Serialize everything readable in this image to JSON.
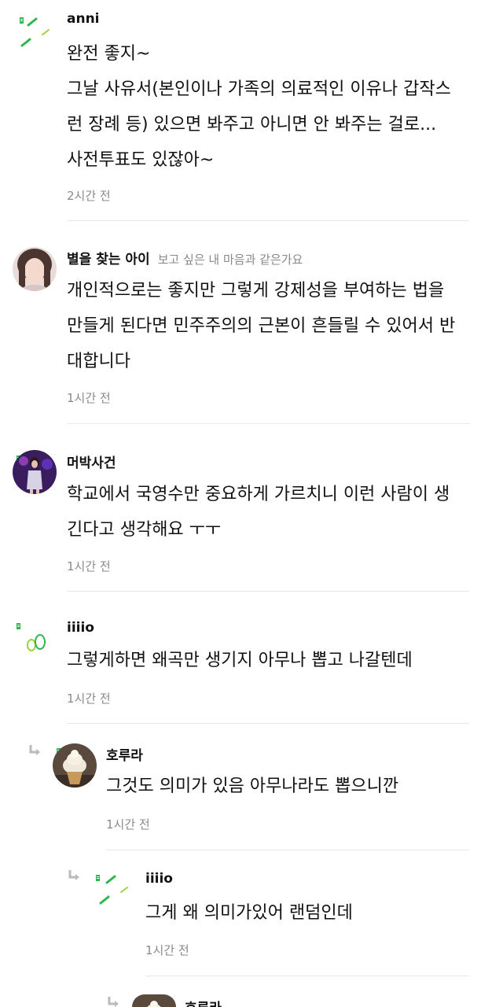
{
  "comments": [
    {
      "nickname": "anni",
      "avatar": "green-dash-icon",
      "lines": [
        "완전 좋지~",
        "그날 사유서(본인이나 가족의 의료적인 이유나 갑작스",
        "런 장례 등) 있으면 봐주고 아니면 안 봐주는 걸로...",
        "사전투표도 있잖아~"
      ],
      "time": "2시간 전"
    },
    {
      "nickname": "별을 찾는 아이",
      "profile_message": "보고 싶은 내 마음과 같은가요",
      "avatar": "girl-photo-avatar",
      "lines": [
        "개인적으로는 좋지만 그렇게 강제성을 부여하는 법을",
        "만들게 된다면 민주주의의 근본이 흔들릴 수 있어서 반",
        "대합니다"
      ],
      "time": "1시간 전"
    },
    {
      "nickname": "머박사건",
      "avatar": "stage-photo-avatar",
      "lines": [
        "학교에서 국영수만 중요하게 가르치니 이런 사람이 생",
        "긴다고 생각해요 ㅜㅜ"
      ],
      "time": "1시간 전"
    },
    {
      "nickname": "iiiio",
      "avatar": "green-circles-icon",
      "lines": [
        "그렇게하면 왜곡만 생기지 아무나 뽑고 나갈텐데"
      ],
      "time": "1시간 전"
    },
    {
      "nickname": "호루라",
      "avatar": "ice-cream-photo-avatar",
      "lines": [
        "그것도 의미가 있음 아무나라도 뽑으니깐"
      ],
      "time": "1시간 전"
    },
    {
      "nickname": "iiiio",
      "avatar": "green-dash-icon",
      "lines": [
        "그게 왜 의미가있어 랜덤인데"
      ],
      "time": "1시간 전"
    },
    {
      "nickname": "호루라",
      "avatar": "ice-cream-photo-avatar",
      "lines": [],
      "time": ""
    }
  ],
  "colors": {
    "accent_green": "#2db84d",
    "time_gray": "#8a8a8a",
    "divider": "#e8e8e8"
  }
}
